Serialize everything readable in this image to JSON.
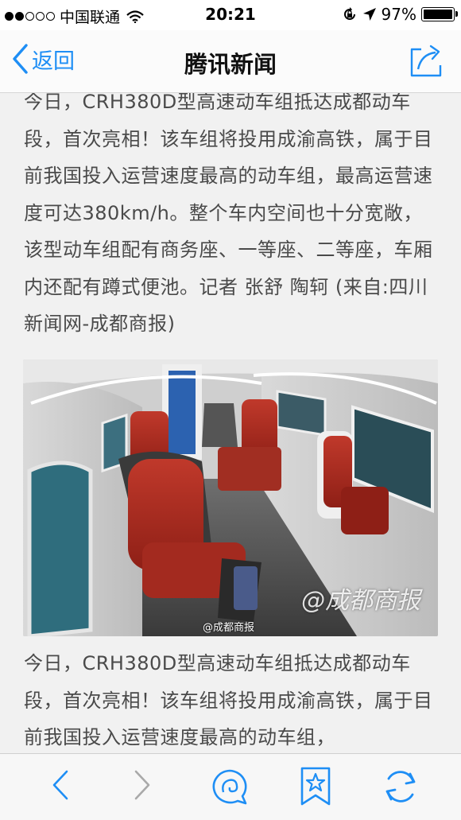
{
  "status_bar": {
    "carrier": "中国联通",
    "time": "20:21",
    "battery": "97%",
    "battery_level": 0.97
  },
  "nav": {
    "back_label": "返回",
    "title": "腾讯新闻"
  },
  "article": {
    "paragraph": "今日，CRH380D型高速动车组抵达成都动车段，首次亮相！该车组将投用成渝高铁，属于目前我国投入运营速度最高的动车组，最高运营速度可达380km/h。整个车内空间也十分宽敞，该型动车组配有商务座、一等座、二等座，车厢内还配有蹲式便池。记者 张舒 陶轲 (来自:四川新闻网-成都商报)",
    "paragraph_repeat": "今日，CRH380D型高速动车组抵达成都动车段，首次亮相！该车组将投用成渝高铁，属于目前我国投入运营速度最高的动车组，",
    "photo_watermark_small": "@成都商报",
    "photo_watermark_big": "@成都商报"
  },
  "toolbar": {
    "icons": [
      "chevron-left-icon",
      "chevron-right-icon",
      "comment-icon",
      "bookmark-star-icon",
      "refresh-icon"
    ]
  },
  "colors": {
    "accent": "#1e8ef5",
    "text": "#4a4a4a",
    "background": "#f1f1f1"
  }
}
